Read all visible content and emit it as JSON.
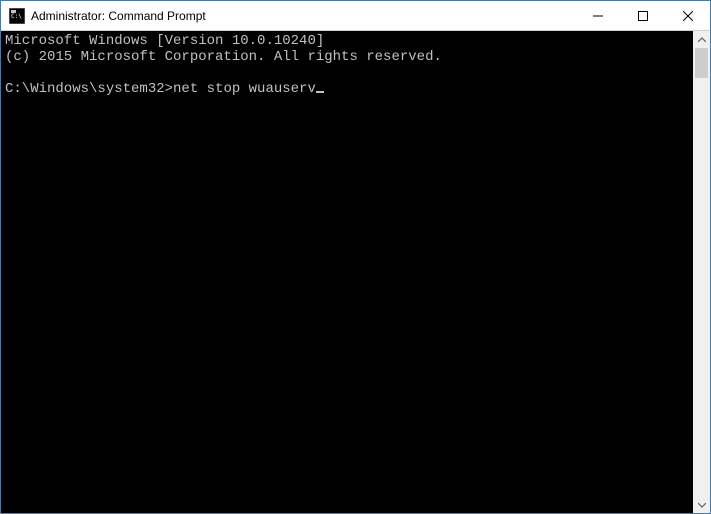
{
  "titlebar": {
    "title": "Administrator: Command Prompt"
  },
  "terminal": {
    "line1": "Microsoft Windows [Version 10.0.10240]",
    "line2": "(c) 2015 Microsoft Corporation. All rights reserved.",
    "prompt": "C:\\Windows\\system32>",
    "command": "net stop wuauserv"
  }
}
